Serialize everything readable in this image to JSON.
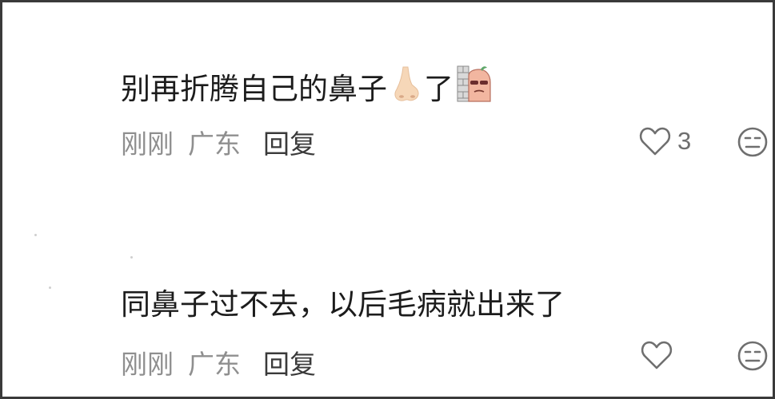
{
  "comments": [
    {
      "text_main": "别再折腾自己的鼻子",
      "text_tail": "了",
      "time": "刚刚",
      "location": "广东",
      "reply_label": "回复",
      "like_count": "3"
    },
    {
      "text_main": "同鼻子过不去，以后毛病就出来了",
      "time": "刚刚",
      "location": "广东",
      "reply_label": "回复"
    }
  ],
  "icons": {
    "nose": "nose-emoji",
    "wall_peek": "peeking-face-emoji",
    "like": "heart-outline-icon",
    "dislike": "neutral-face-icon"
  },
  "colors": {
    "text": "#1c1c1c",
    "meta": "#8f8f8f",
    "reply": "#3a3a3a",
    "icon": "#6f6f6f",
    "border": "#3a3a3a"
  }
}
